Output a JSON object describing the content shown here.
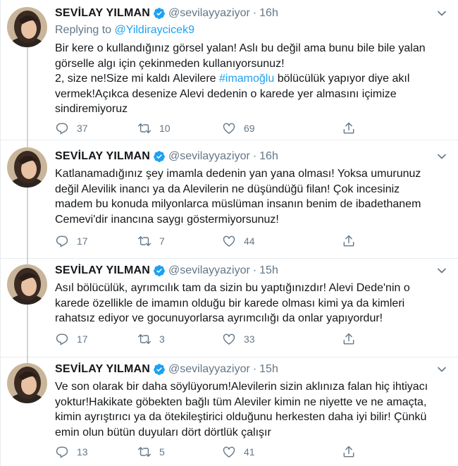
{
  "colors": {
    "link": "#1da1f2",
    "muted": "#657786",
    "text": "#14171a",
    "verified": "#1da1f2",
    "divider": "#e6ecf0"
  },
  "tweets": [
    {
      "name": "SEVİLAY YILMAN",
      "handle": "@sevilayyaziyor",
      "dot": "·",
      "time": "16h",
      "replying_prefix": "Replying to ",
      "replying_to": "@Yildiraycicek9",
      "lines": [
        "Bir kere o kullandığınız görsel yalan! Aslı bu değil ama bunu bile bile yalan",
        "görselle algı için çekinmeden kullanıyorsunuz!",
        "2, size ne!Size mi kaldı Alevilere ",
        "vermek!Açıkca desenize Alevi dedenin o karede yer almasını içimize",
        "sindiremiyoruz"
      ],
      "hashtag": "#imamoğlu",
      "after_hashtag": " bölücülük yapıyor diye akıl",
      "replies": "37",
      "retweets": "10",
      "likes": "69"
    },
    {
      "name": "SEVİLAY YILMAN",
      "handle": "@sevilayyaziyor",
      "dot": "·",
      "time": "16h",
      "lines": [
        "Katlanamadığınız şey imamla dedenin yan yana olması! Yoksa umurunuz",
        "değil Alevilik inancı ya da Alevilerin ne düşündüğü filan! Çok incesiniz",
        "madem bu konuda milyonlarca müslüman insanın benim de ibadethanem",
        "Cemevi'dir inancına saygı göstermiyorsunuz!"
      ],
      "replies": "17",
      "retweets": "7",
      "likes": "44"
    },
    {
      "name": "SEVİLAY YILMAN",
      "handle": "@sevilayyaziyor",
      "dot": "·",
      "time": "15h",
      "lines": [
        "Asıl bölücülük, ayrımcılık tam da sizin bu yaptığınızdır! Alevi Dede'nin o",
        "karede özellikle de imamın olduğu bir karede olması kimi ya da kimleri",
        "rahatsız ediyor ve gocunuyorlarsa ayrımcılığı da onlar yapıyordur!"
      ],
      "replies": "17",
      "retweets": "3",
      "likes": "33"
    },
    {
      "name": "SEVİLAY YILMAN",
      "handle": "@sevilayyaziyor",
      "dot": "·",
      "time": "15h",
      "lines": [
        "Ve son olarak bir daha söylüyorum!Alevilerin sizin aklınıza falan hiç ihtiyacı",
        "yoktur!Hakikate göbekten bağlı tüm Aleviler kimin ne niyette ve ne amaçta,",
        "kimin ayrıştırıcı ya da ötekileştirici olduğunu herkesten daha iyi bilir! Çünkü",
        "emin olun bütün duyuları dört dörtlük çalışır"
      ],
      "replies": "13",
      "retweets": "5",
      "likes": "41"
    }
  ],
  "icons": {
    "reply": "reply-icon",
    "retweet": "retweet-icon",
    "like": "heart-icon",
    "share": "share-icon",
    "caret": "chevron-down-icon",
    "verified": "verified-badge-icon"
  }
}
